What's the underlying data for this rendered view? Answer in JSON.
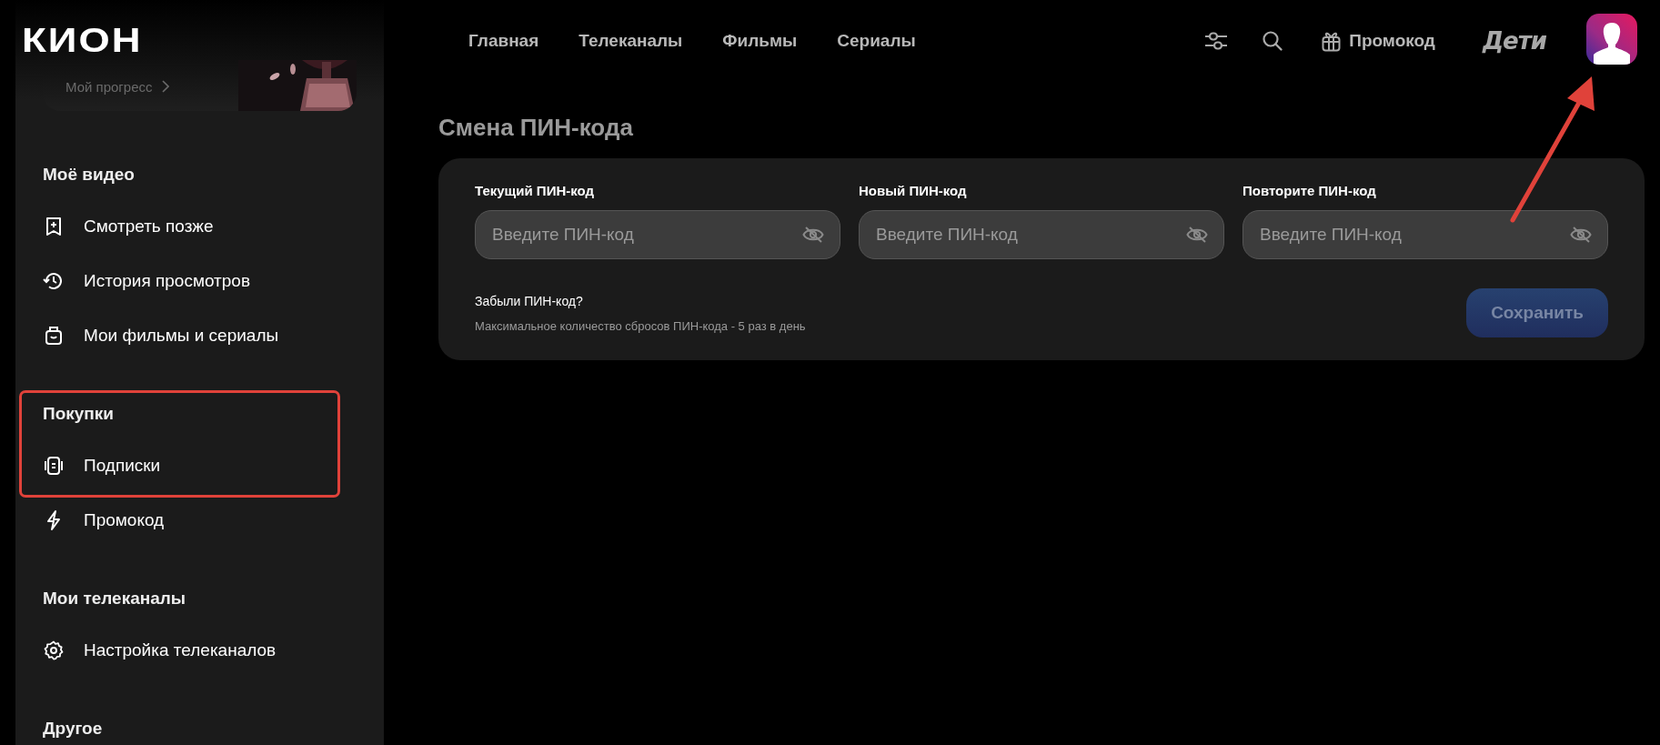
{
  "logo": {
    "text": "КИОН"
  },
  "progress_card": {
    "label": "Мой прогресс"
  },
  "nav": [
    {
      "label": "Главная"
    },
    {
      "label": "Телеканалы"
    },
    {
      "label": "Фильмы"
    },
    {
      "label": "Сериалы"
    }
  ],
  "header_actions": {
    "promo": "Промокод",
    "kids": "Дети"
  },
  "sidebar": {
    "sections": [
      {
        "title": "Моё видео",
        "items": [
          {
            "label": "Смотреть позже"
          },
          {
            "label": "История просмотров"
          },
          {
            "label": "Мои фильмы и сериалы"
          }
        ]
      },
      {
        "title": "Покупки",
        "items": [
          {
            "label": "Подписки"
          },
          {
            "label": "Промокод"
          }
        ]
      },
      {
        "title": "Мои телеканалы",
        "items": [
          {
            "label": "Настройка телеканалов"
          }
        ]
      },
      {
        "title": "Другое"
      }
    ]
  },
  "page_title": "Смена ПИН-кода",
  "fields": [
    {
      "label": "Текущий ПИН-код",
      "placeholder": "Введите ПИН-код"
    },
    {
      "label": "Новый ПИН-код",
      "placeholder": "Введите ПИН-код"
    },
    {
      "label": "Повторите ПИН-код",
      "placeholder": "Введите ПИН-код"
    }
  ],
  "forgot_link": "Забыли ПИН-код?",
  "note": "Максимальное количество сбросов ПИН-кода - 5 раз в день",
  "save_button": {
    "label": "Сохранить",
    "disabled": true
  }
}
